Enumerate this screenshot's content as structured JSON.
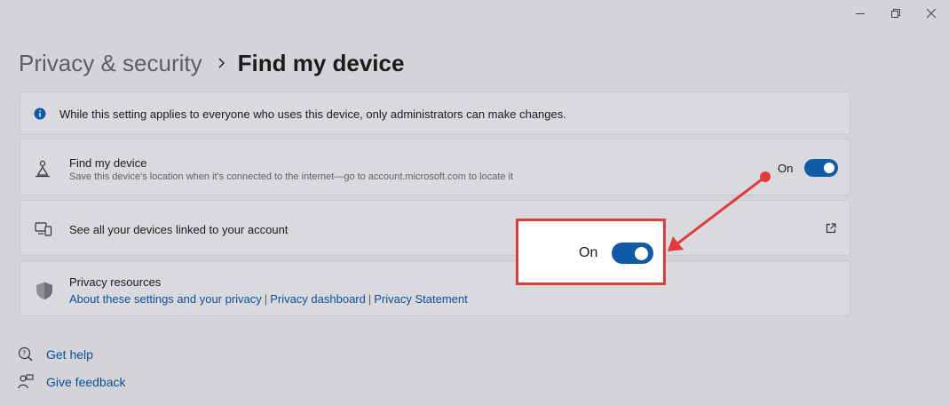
{
  "window": {
    "controls": [
      "minimize",
      "restore",
      "close"
    ]
  },
  "breadcrumb": {
    "parent": "Privacy & security",
    "separator_icon": "chevron-right-icon",
    "current": "Find my device"
  },
  "info_banner": {
    "icon": "info-icon",
    "text": "While this setting applies to everyone who uses this device, only administrators can make changes."
  },
  "find_my_device": {
    "icon": "person-location-icon",
    "title": "Find my device",
    "description": "Save this device's location when it's connected to the internet—go to account.microsoft.com to locate it",
    "toggle_state": "On",
    "toggle_on": true
  },
  "linked_devices": {
    "icon": "devices-icon",
    "title": "See all your devices linked to your account",
    "action_icon": "open-external-icon"
  },
  "privacy_resources": {
    "icon": "shield-icon",
    "title": "Privacy resources",
    "links": [
      "About these settings and your privacy",
      "Privacy dashboard",
      "Privacy Statement"
    ],
    "separator": "|"
  },
  "callout": {
    "toggle_state": "On",
    "toggle_on": true,
    "border_color": "#e23b3b"
  },
  "footer": {
    "get_help": "Get help",
    "give_feedback": "Give feedback"
  },
  "colors": {
    "accent": "#0f5ba7",
    "link": "#0f4f9a",
    "annotation": "#e23b3b",
    "background": "#d2d4d8"
  }
}
